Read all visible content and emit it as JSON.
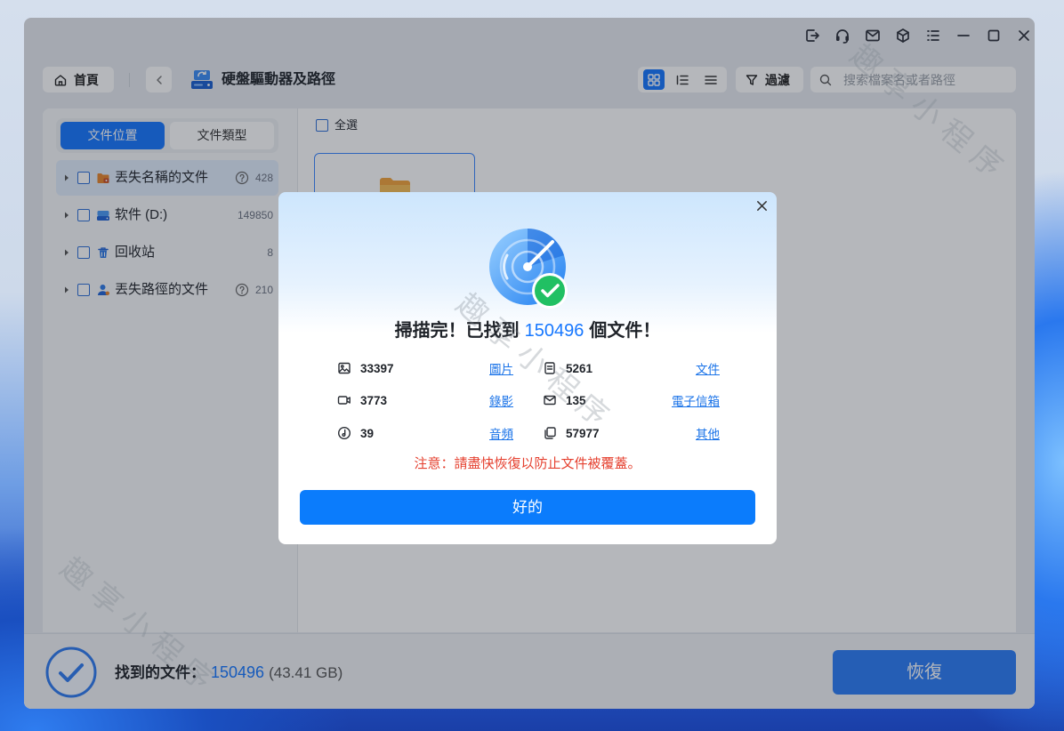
{
  "window": {
    "titlebar_icons": [
      "export-icon",
      "headset-icon",
      "mail-icon",
      "cube-icon",
      "menu-icon",
      "minimize-icon",
      "maximize-icon",
      "close-icon"
    ]
  },
  "toolbar": {
    "home_icon": "home-icon",
    "home_label": "首頁",
    "back_icon": "chevron-left-icon",
    "location_icon": "hard-drive-icon",
    "location_title": "硬盤驅動器及路徑",
    "views": [
      {
        "icon": "grid-view-icon",
        "active": true
      },
      {
        "icon": "list-view-icon",
        "active": false
      },
      {
        "icon": "detail-view-icon",
        "active": false
      }
    ],
    "filter_icon": "filter-icon",
    "filter_label": "過濾",
    "search_icon": "search-icon",
    "search_placeholder": "搜索檔案名或者路徑"
  },
  "sidebar": {
    "tabs": [
      {
        "label": "文件位置",
        "active": true
      },
      {
        "label": "文件類型",
        "active": false
      }
    ],
    "items": [
      {
        "label": "丟失名稱的文件",
        "count": "428",
        "icon": "lost-name-folder-icon",
        "has_help": true,
        "selected": true,
        "checked": false
      },
      {
        "label": "软件 (D:)",
        "count": "149850",
        "icon": "drive-icon",
        "has_help": false,
        "selected": false,
        "checked": false
      },
      {
        "label": "回收站",
        "count": "8",
        "icon": "recycle-bin-icon",
        "has_help": false,
        "selected": false,
        "checked": false
      },
      {
        "label": "丟失路徑的文件",
        "count": "210",
        "icon": "lost-path-icon",
        "has_help": true,
        "selected": false,
        "checked": false
      }
    ]
  },
  "content": {
    "select_all_label": "全選",
    "select_all_checked": false,
    "items": [
      {
        "icon": "folder-icon",
        "selected": true
      }
    ]
  },
  "footer": {
    "status_icon": "check-circle-icon",
    "found_label": "找到的文件：",
    "found_count": "150496",
    "found_size": "(43.41 GB)",
    "recover_label": "恢復"
  },
  "dialog": {
    "close_icon": "close-icon",
    "icon": "scan-complete-icon",
    "heading_prefix": "掃描完！已找到",
    "heading_count": "150496",
    "heading_suffix": "個文件！",
    "stats": [
      {
        "icon": "image-icon",
        "count": "33397",
        "label": "圖片"
      },
      {
        "icon": "document-icon",
        "count": "5261",
        "label": "文件"
      },
      {
        "icon": "video-icon",
        "count": "3773",
        "label": "錄影"
      },
      {
        "icon": "mail-icon",
        "count": "135",
        "label": "電子信箱"
      },
      {
        "icon": "music-icon",
        "count": "39",
        "label": "音頻"
      },
      {
        "icon": "copy-icon",
        "count": "57977",
        "label": "其他"
      }
    ],
    "warning": "注意：請盡快恢復以防止文件被覆蓋。",
    "ok_label": "好的"
  },
  "watermark": "趣享小程序",
  "colors": {
    "accent": "#1677ff",
    "warning": "#e5402f",
    "success": "#21c063",
    "folder": "#f2a33a"
  }
}
